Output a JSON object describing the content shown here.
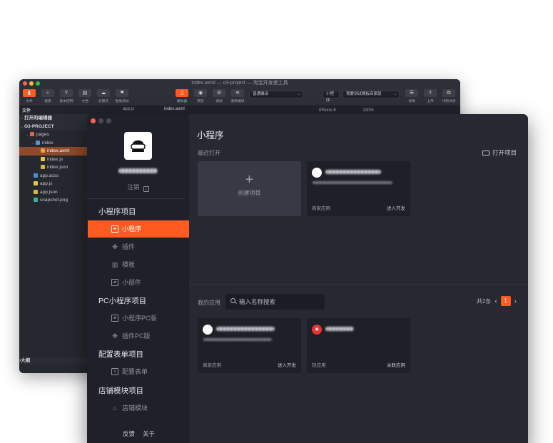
{
  "ide": {
    "title": "index.axml — o3-project — 淘宝开发者工具",
    "toolbar": {
      "file": "文件",
      "search": "搜索",
      "vcs": "基本控制",
      "docs": "文档",
      "cloud": "云服务",
      "perf": "性能调试",
      "simulator": "模拟器",
      "preview": "预览",
      "debug": "调试",
      "recompile": "重新编译",
      "compile_mode": "普通编译",
      "app_type": "小程序",
      "app_name": "我要测试模板商家版",
      "details": "详情",
      "upload": "上传",
      "share": "代码共享"
    },
    "tabs": {
      "tab1": "app.js",
      "tab2": "index.axml",
      "device": "iPhone 6",
      "zoom": "100%"
    },
    "explorer": {
      "header": "文件",
      "open_editors": "打开的编辑器",
      "project": "O3-PROJECT",
      "pages": "pages",
      "index_folder": "index",
      "files": [
        "index.axml",
        "index.js",
        "index.json"
      ],
      "root_files": [
        "app.acss",
        "app.js",
        "app.json",
        "snapshot.png"
      ],
      "outline": "大纲"
    }
  },
  "launcher": {
    "logout": "注销",
    "sections": {
      "mini": "小程序项目",
      "pc": "PC小程序项目",
      "form": "配置表单项目",
      "shop": "店铺模块项目"
    },
    "menu": {
      "mini_program": "小程序",
      "plugin": "插件",
      "template": "模板",
      "widget": "小部件",
      "mini_pc": "小程序PC版",
      "plugin_pc": "插件PC版",
      "config_form": "配置表单",
      "shop_module": "店铺模块"
    },
    "footer": {
      "feedback": "反馈",
      "about": "关于"
    },
    "main": {
      "title": "小程序",
      "recent": "最近打开",
      "open_project": "打开项目",
      "create": "创建项目",
      "recent_card": {
        "tag": "商家应用",
        "action": "进入开发"
      },
      "my_apps": "我的应用",
      "search_placeholder": "输入名称搜索",
      "total": "共2条",
      "page": "1",
      "apps": [
        {
          "tag": "商家应用",
          "action": "进入开发"
        },
        {
          "tag": "轻应用",
          "action": "关联应用"
        }
      ]
    }
  },
  "colors": {
    "accent": "#ff5a1f",
    "sidebar": "#1f2029",
    "main": "#262832"
  }
}
